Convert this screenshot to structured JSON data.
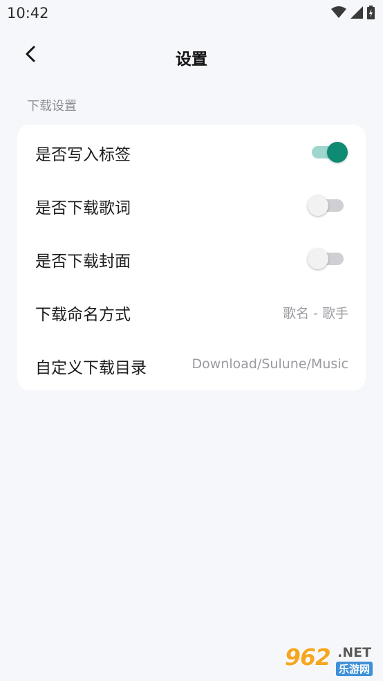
{
  "status_bar": {
    "time": "10:42",
    "icons": [
      "wifi-icon",
      "signal-icon",
      "battery-charging-icon"
    ]
  },
  "app_bar": {
    "back_icon": "chevron-left-icon",
    "title": "设置"
  },
  "section": {
    "header": "下载设置",
    "rows": [
      {
        "label": "是否写入标签",
        "type": "switch",
        "on": true
      },
      {
        "label": "是否下载歌词",
        "type": "switch",
        "on": false
      },
      {
        "label": "是否下载封面",
        "type": "switch",
        "on": false
      },
      {
        "label": "下载命名方式",
        "type": "value",
        "value": "歌名 - 歌手"
      },
      {
        "label": "自定义下载目录",
        "type": "value",
        "value": "Download/Sulune/Music"
      }
    ]
  },
  "colors": {
    "accent": "#0f8a73",
    "accent_track": "#9fd7cf",
    "background": "#f6f7fb",
    "card": "#ffffff"
  },
  "watermark": {
    "number": "962",
    "domain": ".NET",
    "cn": "乐游网"
  }
}
